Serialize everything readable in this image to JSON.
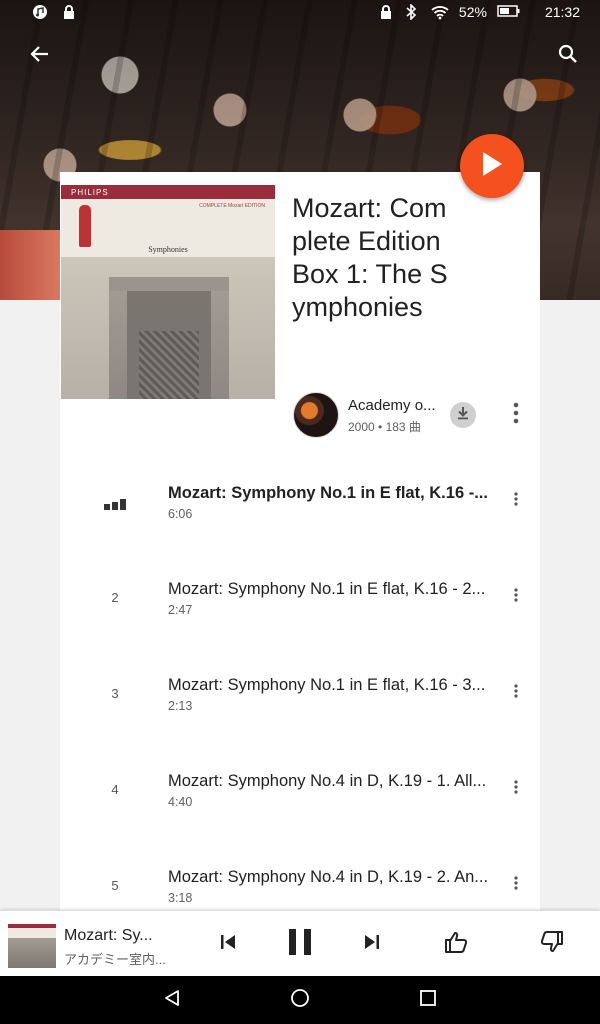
{
  "status_bar": {
    "battery": "52%",
    "time": "21:32"
  },
  "album": {
    "title": "Mozart: Complete Edition Box 1: The Symphonies",
    "artist": "Academy o...",
    "meta": "2000 • 183 曲",
    "cover_label": "PHILIPS",
    "cover_top_label": "COMPLETE Mozart EDITION",
    "cover_subtitle": "Symphonies"
  },
  "tracks": [
    {
      "index": "",
      "title": "Mozart: Symphony No.1 in E flat, K.16 -...",
      "duration": "6:06",
      "playing": true
    },
    {
      "index": "2",
      "title": "Mozart: Symphony No.1 in E flat, K.16 - 2...",
      "duration": "2:47"
    },
    {
      "index": "3",
      "title": "Mozart: Symphony No.1 in E flat, K.16 - 3...",
      "duration": "2:13"
    },
    {
      "index": "4",
      "title": "Mozart: Symphony No.4 in D, K.19 - 1. All...",
      "duration": "4:40"
    },
    {
      "index": "5",
      "title": "Mozart: Symphony No.4 in D, K.19 - 2. An...",
      "duration": "3:18"
    }
  ],
  "mini_player": {
    "title": "Mozart: Sy...",
    "subtitle": "アカデミー室内..."
  },
  "colors": {
    "accent": "#f4511e",
    "card": "#ffffff",
    "background": "#f1f1f1",
    "navbar": "#000000"
  },
  "icons": {
    "back": "arrow-left-icon",
    "search": "search-icon",
    "play": "play-icon",
    "download": "download-icon",
    "more": "more-vert-icon",
    "equalizer": "equalizer-icon",
    "prev": "skip-previous-icon",
    "pause": "pause-icon",
    "next": "skip-next-icon",
    "like": "thumb-up-icon",
    "dislike": "thumb-down-icon",
    "nav_back": "nav-back-icon",
    "nav_home": "nav-home-icon",
    "nav_recents": "nav-recents-icon"
  }
}
